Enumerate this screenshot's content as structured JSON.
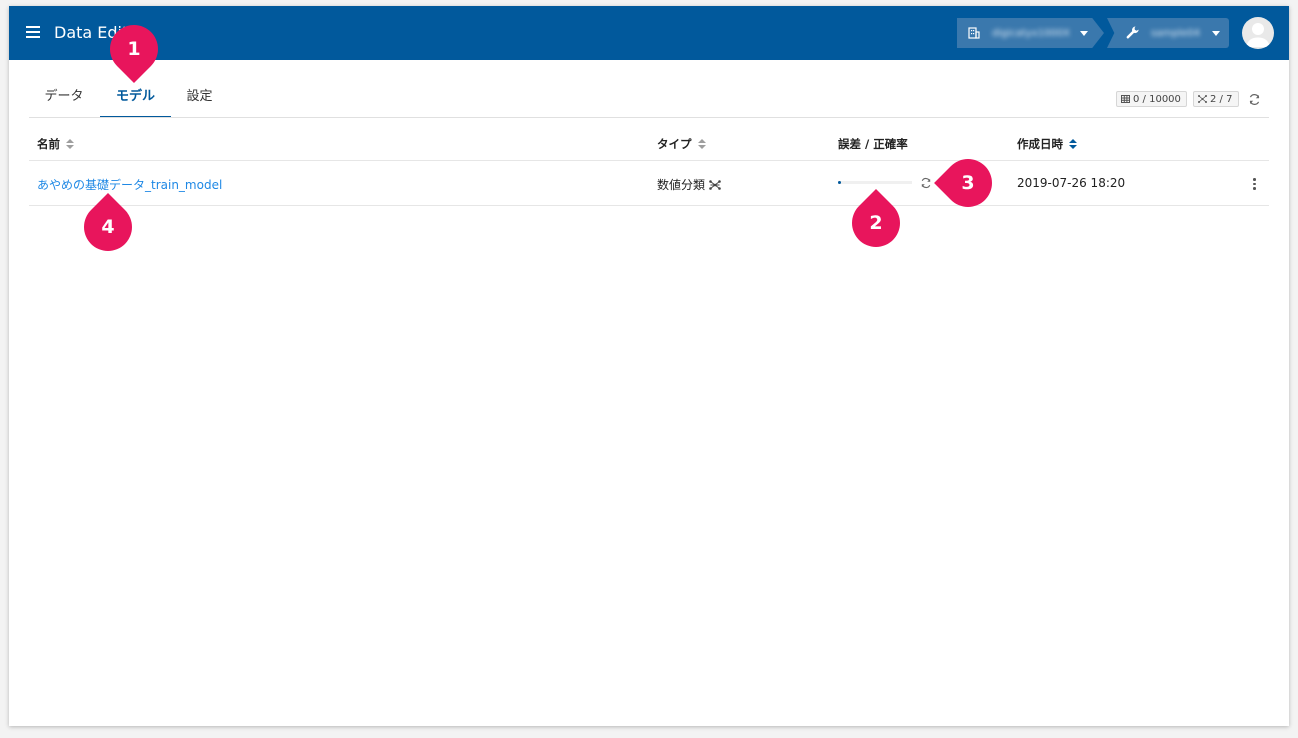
{
  "app": {
    "title": "Data Edit"
  },
  "header": {
    "organization": "digicatyx1000X",
    "project": "sample04"
  },
  "tabs": [
    {
      "label": "データ",
      "active": false
    },
    {
      "label": "モデル",
      "active": true
    },
    {
      "label": "設定",
      "active": false
    }
  ],
  "stats": {
    "rows": "0 / 10000",
    "models": "2 / 7"
  },
  "table": {
    "headers": {
      "name": "名前",
      "type": "タイプ",
      "score": "誤差 / 正確率",
      "created": "作成日時"
    },
    "rows": [
      {
        "name": "あやめの基礎データ_train_model",
        "type": "数値分類",
        "progress": 0.04,
        "created": "2019-07-26 18:20"
      }
    ]
  },
  "markers": {
    "m1": "1",
    "m2": "2",
    "m3": "3",
    "m4": "4"
  },
  "colors": {
    "appbar": "#01599c",
    "accent": "#01599c",
    "link": "#1e88e5",
    "marker": "#e8155c"
  }
}
